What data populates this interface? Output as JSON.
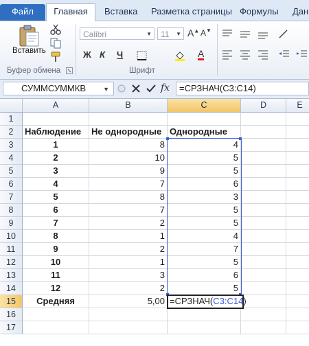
{
  "ribbon_tabs": [
    "Файл",
    "Главная",
    "Вставка",
    "Разметка страницы",
    "Формулы",
    "Дан"
  ],
  "ribbon": {
    "paste_label": "Вставить",
    "clipboard_group": "Буфер обмена",
    "font_group": "Шрифт",
    "font_name": "Calibri",
    "font_size": "11"
  },
  "formula_bar": {
    "name_box": "СУММСУММКВ",
    "formula": "=СРЗНАЧ(C3:C14)"
  },
  "columns": [
    "A",
    "B",
    "C",
    "D",
    "E"
  ],
  "rows": [
    "1",
    "2",
    "3",
    "4",
    "5",
    "6",
    "7",
    "8",
    "9",
    "10",
    "11",
    "12",
    "13",
    "14",
    "15",
    "16",
    "17"
  ],
  "sheet": {
    "headers": {
      "a": "Наблюдение",
      "b": "Не однородные",
      "c": "Однородные"
    },
    "data": [
      {
        "a": "1",
        "b": "8",
        "c": "4"
      },
      {
        "a": "2",
        "b": "10",
        "c": "5"
      },
      {
        "a": "3",
        "b": "9",
        "c": "5"
      },
      {
        "a": "4",
        "b": "7",
        "c": "6"
      },
      {
        "a": "5",
        "b": "8",
        "c": "3"
      },
      {
        "a": "6",
        "b": "7",
        "c": "5"
      },
      {
        "a": "7",
        "b": "2",
        "c": "5"
      },
      {
        "a": "8",
        "b": "1",
        "c": "4"
      },
      {
        "a": "9",
        "b": "2",
        "c": "7"
      },
      {
        "a": "10",
        "b": "1",
        "c": "5"
      },
      {
        "a": "11",
        "b": "3",
        "c": "6"
      },
      {
        "a": "12",
        "b": "2",
        "c": "5"
      }
    ],
    "summary": {
      "a": "Средняя",
      "b": "5,00",
      "c_prefix": "=СРЗНАЧ(",
      "c_ref": "C3:C14",
      "c_suffix": ")"
    }
  }
}
